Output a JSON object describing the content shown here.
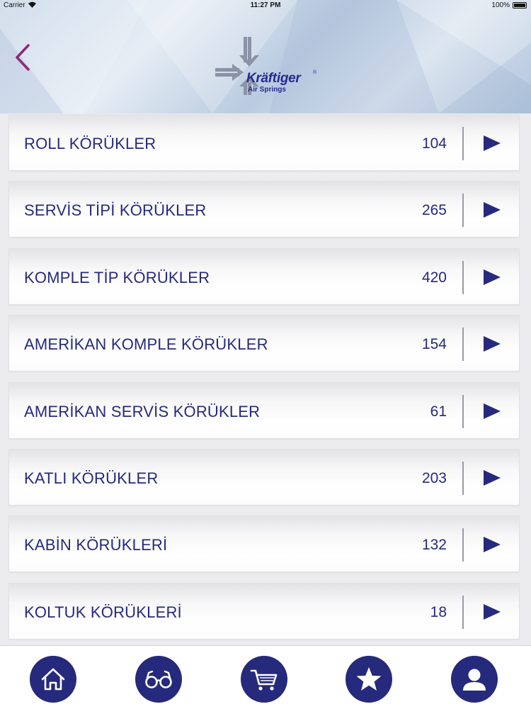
{
  "status_bar": {
    "carrier": "Carrier",
    "time": "11:27 PM",
    "battery": "100%"
  },
  "header": {
    "back_icon": "chevron-left-icon",
    "logo_brand": "Kräftiger",
    "logo_sub": "Air Springs",
    "logo_reg": "®"
  },
  "categories": [
    {
      "label": "ROLL KÖRÜKLER",
      "count": "104"
    },
    {
      "label": "SERVİS TİPİ KÖRÜKLER",
      "count": "265"
    },
    {
      "label": "KOMPLE TİP KÖRÜKLER",
      "count": "420"
    },
    {
      "label": "AMERİKAN KOMPLE KÖRÜKLER",
      "count": "154"
    },
    {
      "label": "AMERİKAN SERVİS KÖRÜKLER",
      "count": "61"
    },
    {
      "label": "KATLI KÖRÜKLER",
      "count": "203"
    },
    {
      "label": "KABİN KÖRÜKLERİ",
      "count": "132"
    },
    {
      "label": "KOLTUK KÖRÜKLERİ",
      "count": "18"
    }
  ],
  "tabbar": {
    "items": [
      "home-icon",
      "glasses-icon",
      "cart-icon",
      "star-icon",
      "user-icon"
    ]
  },
  "colors": {
    "accent": "#262a7c",
    "back_chevron": "#8a2a7a",
    "divider": "#9a9aa4"
  }
}
